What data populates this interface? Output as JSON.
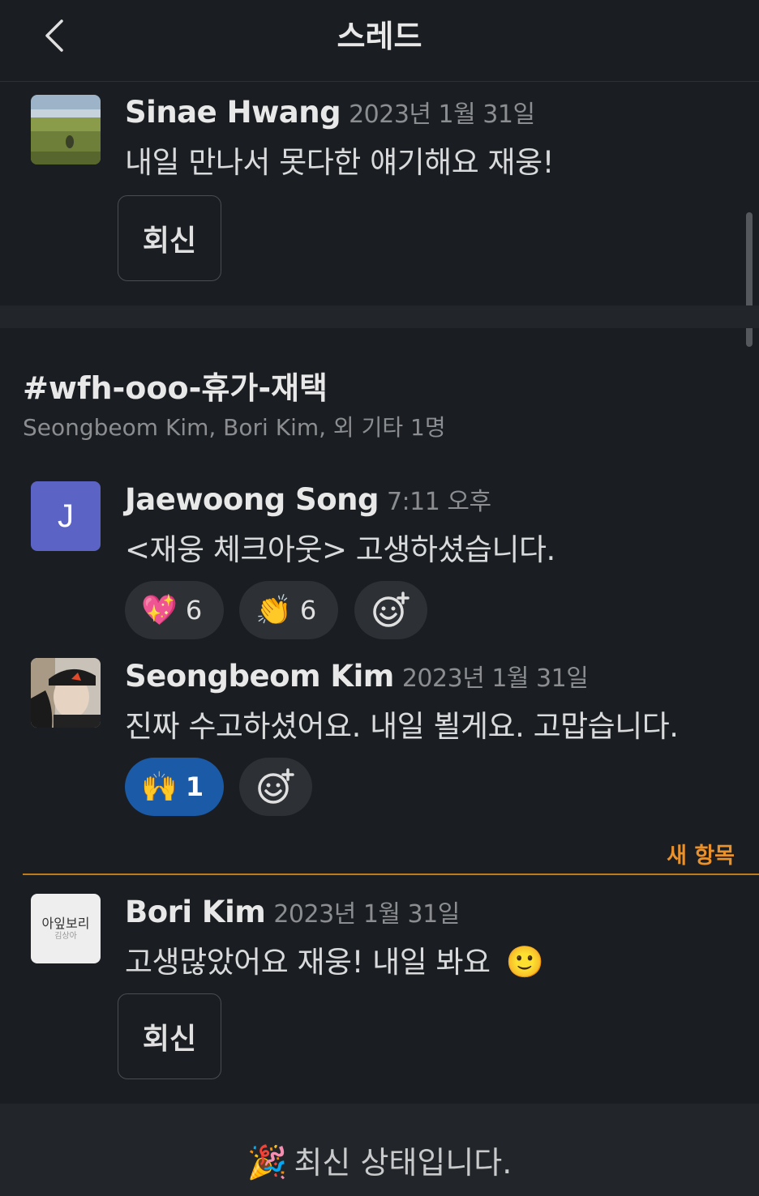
{
  "header": {
    "title": "스레드",
    "back_icon": "chevron-left-icon"
  },
  "thread1": {
    "author": "Sinae Hwang",
    "time": "2023년 1월 31일",
    "text": "내일 만나서 못다한 얘기해요 재웅!",
    "reply_label": "회신"
  },
  "channel": {
    "name": "#wfh-ooo-휴가-재택",
    "members": "Seongbeom Kim, Bori Kim, 외 기타 1명"
  },
  "messages": [
    {
      "author": "Jaewoong Song",
      "time": "7:11 오후",
      "text": "<재웅 체크아웃> 고생하셨습니다.",
      "avatar_initial": "J",
      "reactions": [
        {
          "emoji": "💖",
          "count": "6"
        },
        {
          "emoji": "👏",
          "count": "6"
        }
      ]
    },
    {
      "author": "Seongbeom Kim",
      "time": "2023년 1월 31일",
      "text": "진짜 수고하셨어요. 내일 뵐게요. 고맙습니다.",
      "reactions": [
        {
          "emoji": "🙌",
          "count": "1",
          "active": true
        }
      ]
    },
    {
      "author": "Bori Kim",
      "time": "2023년 1월 31일",
      "text": "고생많았어요 재웅! 내일 봐요",
      "trailing_emoji": "🙂",
      "avatar_text": "아잎보리",
      "avatar_subtext": "김상아",
      "reply_label": "회신"
    }
  ],
  "new_items_label": "새 항목",
  "footer": {
    "emoji": "🎉",
    "text": "최신 상태입니다."
  },
  "colors": {
    "background": "#1a1d21",
    "accent_new": "#e8912d",
    "reaction_active": "#1a5aa6",
    "avatar_j": "#5b63c4"
  }
}
